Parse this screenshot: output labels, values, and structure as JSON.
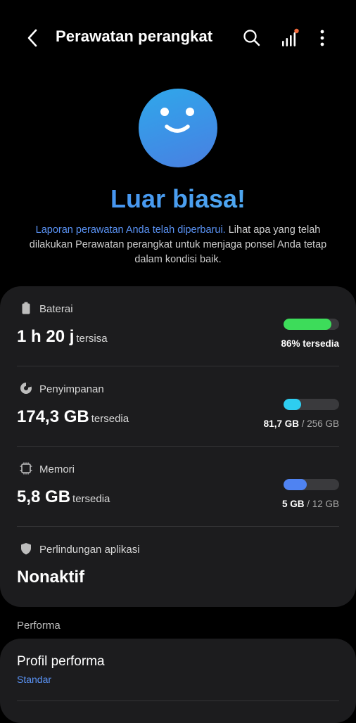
{
  "header": {
    "title": "Perawatan perangkat",
    "icons": [
      "back-icon",
      "search-icon",
      "stats-icon",
      "more-icon"
    ]
  },
  "hero": {
    "title": "Luar biasa!",
    "desc_link": "Laporan perawatan Anda telah diperbarui.",
    "desc_text": " Lihat apa yang telah dilakukan Perawatan perangkat untuk menjaga ponsel Anda tetap dalam kondisi baik."
  },
  "battery": {
    "label": "Baterai",
    "value": "1 h 20 j",
    "suffix": "tersisa",
    "caption": "86% tersedia",
    "level_percent": 86,
    "color": "#3ddc5a"
  },
  "storage": {
    "label": "Penyimpanan",
    "value": "174,3 GB",
    "suffix": "tersedia",
    "used": "81,7 GB",
    "sep": " / ",
    "total": "256 GB",
    "used_fraction": 0.32,
    "color": "#2ecdf0"
  },
  "memory": {
    "label": "Memori",
    "value": "5,8 GB",
    "suffix": "tersedia",
    "used": "5 GB",
    "sep": " / ",
    "total": "12 GB",
    "used_fraction": 0.42,
    "color": "#4f83f2"
  },
  "protection": {
    "label": "Perlindungan aplikasi",
    "value": "Nonaktif"
  },
  "performance": {
    "section_label": "Performa",
    "title": "Profil performa",
    "subtitle": "Standar"
  },
  "colors": {
    "accent": "#5a93f5",
    "card": "#1c1c1e",
    "notification_dot": "#f26a3c"
  }
}
